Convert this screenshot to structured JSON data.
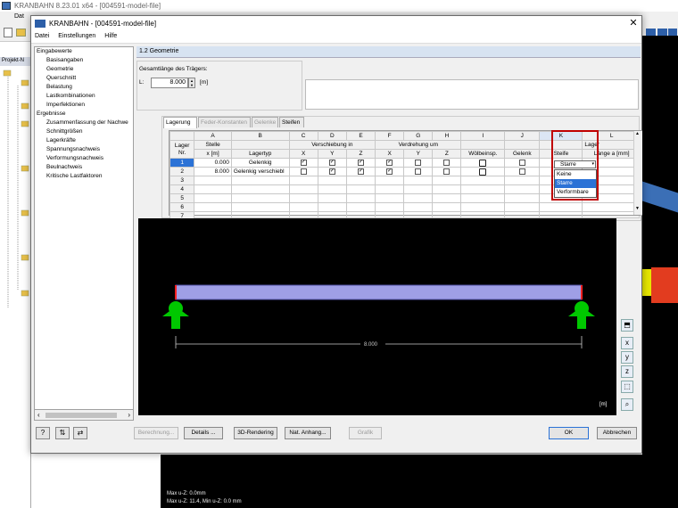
{
  "background_app": {
    "title": "KRANBAHN 8.23.01 x64 - [004591-model-file]",
    "menu_first": "Dat",
    "panel_label": "Projekt-N",
    "status_line1": "Max u-Z: 0.0mm",
    "status_line2": "Max u-Z: 11.4, Min u-Z: 0.0 mm"
  },
  "dialog": {
    "title": "KRANBAHN - [004591-model-file]",
    "close_glyph": "✕",
    "menu": [
      "Datei",
      "Einstellungen",
      "Hilfe"
    ]
  },
  "tree": {
    "group1": "Eingabewerte",
    "group1_items": [
      "Basisangaben",
      "Geometrie",
      "Querschnitt",
      "Belastung",
      "Lastkombinationen",
      "Imperfektionen"
    ],
    "group2": "Ergebnisse",
    "group2_items": [
      "Zusammenfassung der Nachwe",
      "Schnittgrößen",
      "Lagerkräfte",
      "Spannungsnachweis",
      "Verformungsnachweis",
      "Beulnachweis",
      "Kritische Lastfaktoren"
    ]
  },
  "section": {
    "header": "1.2 Geometrie",
    "length_label": "Gesamtlänge des Trägers:",
    "L_label": "L:",
    "L_value": "8.000",
    "L_unit": "[m]"
  },
  "tabs": [
    {
      "label": "Lagerung",
      "active": true
    },
    {
      "label": "Feder-Konstanten",
      "active": false
    },
    {
      "label": "Gelenke",
      "active": false
    },
    {
      "label": "Steifen",
      "active": false
    }
  ],
  "grid": {
    "col_letters": [
      "A",
      "B",
      "C",
      "D",
      "E",
      "F",
      "G",
      "H",
      "I",
      "J",
      "K",
      "L"
    ],
    "lager_label": "Lager",
    "nr_label": "Nr.",
    "stelle_label": "Stelle",
    "x_m_label": "x [m]",
    "lagertyp_label": "Lagertyp",
    "verschiebung_label": "Verschiebung in",
    "verdrehung_label": "Verdrehung um",
    "axis_x": "X",
    "axis_y": "Y",
    "axis_z": "Z",
    "woelbeinsp_label": "Wölbeinsp.",
    "gelenk_label": "Gelenk",
    "steife_label": "Steife",
    "lager_l_label": "Lager",
    "laenge_label": "Länge a [mm]",
    "rows": [
      {
        "nr": "1",
        "x": "0.000",
        "typ": "Gelenkig",
        "vx": true,
        "vy": true,
        "vz": true,
        "rx": true,
        "ry": false,
        "rz": false,
        "woelb": false,
        "gelenk": false,
        "steife": "Starre"
      },
      {
        "nr": "2",
        "x": "8.000",
        "typ": "Gelenkig verschiebl",
        "vx": false,
        "vy": true,
        "vz": true,
        "rx": true,
        "ry": false,
        "rz": false,
        "woelb": false,
        "gelenk": false,
        "steife": ""
      }
    ],
    "empty_rows": [
      "3",
      "4",
      "5",
      "6",
      "7"
    ],
    "dropdown_options": [
      "Keine",
      "Starre",
      "Verformbare"
    ],
    "dropdown_selected": "Starre"
  },
  "graphic": {
    "dimension_label": "8.000",
    "unit_label": "[m]",
    "beam_color": "#9f9fe6",
    "support_color": "#00c800"
  },
  "buttons": {
    "berechnung": "Berechnung...",
    "details": "Details ...",
    "rendering": "3D-Rendering",
    "nat_anhang": "Nat. Anhang...",
    "grafik": "Grafik",
    "ok": "OK",
    "abbrechen": "Abbrechen"
  }
}
